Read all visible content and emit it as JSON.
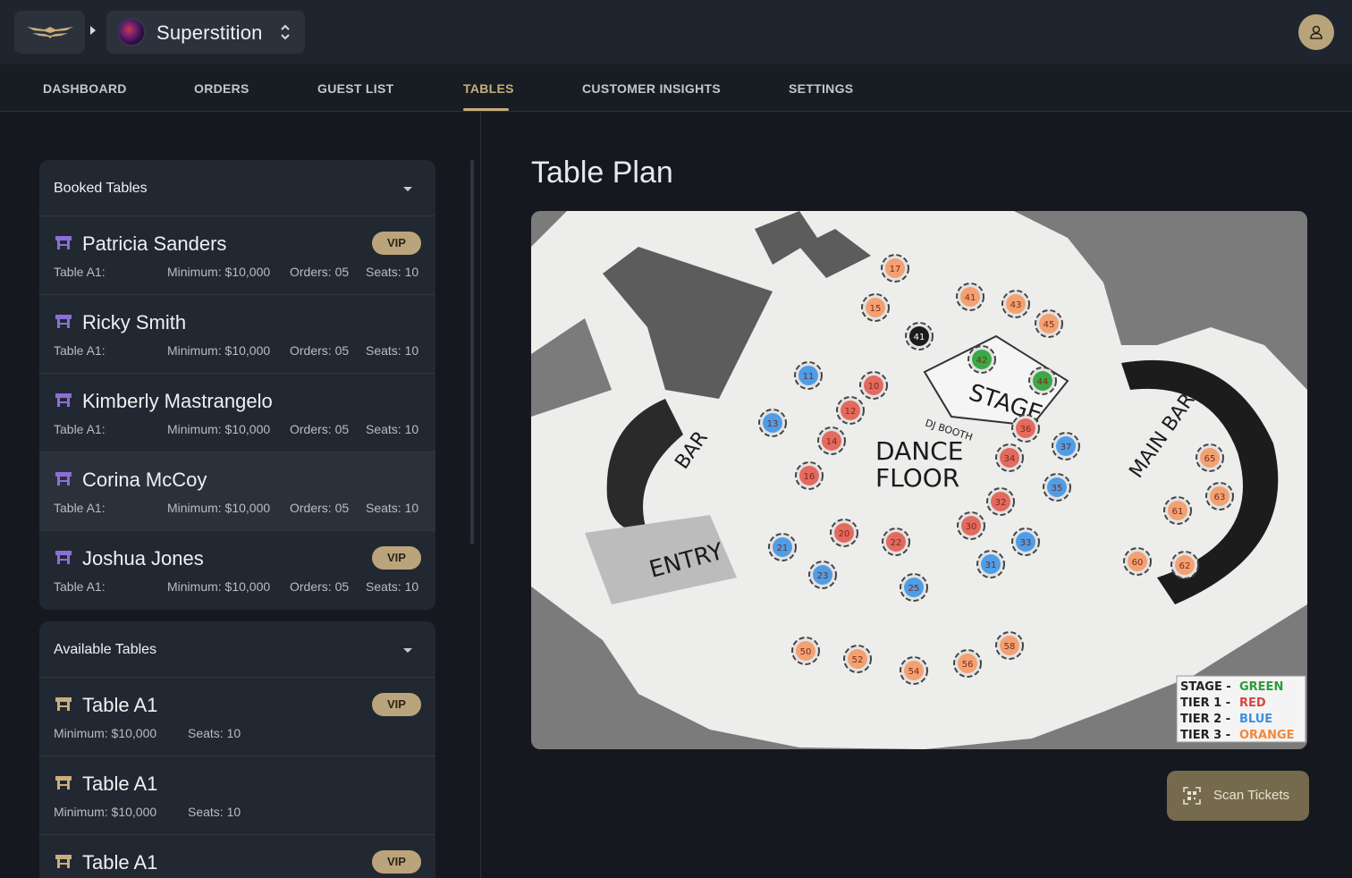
{
  "header": {
    "venue_name": "Superstition",
    "icons": {
      "logo": "wings-logo-icon",
      "breadcrumb": "chevron-right-icon",
      "switcher": "up-down-chevron-icon",
      "user": "user-icon"
    }
  },
  "nav": {
    "tabs": [
      {
        "label": "DASHBOARD"
      },
      {
        "label": "ORDERS"
      },
      {
        "label": "GUEST LIST"
      },
      {
        "label": "TABLES",
        "active": true
      },
      {
        "label": "CUSTOMER INSIGHTS"
      },
      {
        "label": "SETTINGS"
      }
    ]
  },
  "booked": {
    "title": "Booked Tables",
    "rows": [
      {
        "name": "Patricia Sanders",
        "table": "Table A1:",
        "minimum": "Minimum: $10,000",
        "orders": "Orders: 05",
        "seats": "Seats: 10",
        "vip": "VIP"
      },
      {
        "name": "Ricky Smith",
        "table": "Table A1:",
        "minimum": "Minimum: $10,000",
        "orders": "Orders: 05",
        "seats": "Seats: 10"
      },
      {
        "name": "Kimberly Mastrangelo",
        "table": "Table A1:",
        "minimum": "Minimum: $10,000",
        "orders": "Orders: 05",
        "seats": "Seats: 10"
      },
      {
        "name": "Corina McCoy",
        "table": "Table A1:",
        "minimum": "Minimum: $10,000",
        "orders": "Orders: 05",
        "seats": "Seats: 10",
        "selected": true
      },
      {
        "name": "Joshua Jones",
        "table": "Table A1:",
        "minimum": "Minimum: $10,000",
        "orders": "Orders: 05",
        "seats": "Seats: 10",
        "vip": "VIP"
      }
    ]
  },
  "available": {
    "title": "Available Tables",
    "rows": [
      {
        "name": "Table A1",
        "minimum": "Minimum: $10,000",
        "seats": "Seats: 10",
        "vip": "VIP"
      },
      {
        "name": "Table A1",
        "minimum": "Minimum: $10,000",
        "seats": "Seats: 10"
      },
      {
        "name": "Table A1",
        "vip": "VIP"
      }
    ]
  },
  "plan": {
    "title": "Table Plan",
    "labels": {
      "stage": "STAGE",
      "dj": "DJ BOOTH",
      "dance1": "DANCE",
      "dance2": "FLOOR",
      "bar": "BAR",
      "main_bar": "MAIN BAR",
      "entry": "ENTRY"
    },
    "legend": [
      {
        "tier": "STAGE - ",
        "color_name": "GREEN",
        "color": "#2e9a3a"
      },
      {
        "tier": "TIER 1 - ",
        "color_name": "RED",
        "color": "#d9463c"
      },
      {
        "tier": "TIER 2 - ",
        "color_name": "BLUE",
        "color": "#3d8fe0"
      },
      {
        "tier": "TIER 3 - ",
        "color_name": "ORANGE",
        "color": "#f08a3c"
      }
    ],
    "colors": {
      "stage": "#3aa846",
      "tier1": "#e36a5e",
      "tier2": "#4f9de6",
      "tier3": "#f3a172",
      "selected": "#1b1b1b"
    },
    "tables": [
      {
        "n": "17",
        "tier": "tier3"
      },
      {
        "n": "15",
        "tier": "tier3"
      },
      {
        "n": "41",
        "tier": "selected"
      },
      {
        "n": "41",
        "tier": "tier3"
      },
      {
        "n": "43",
        "tier": "tier3"
      },
      {
        "n": "45",
        "tier": "tier3"
      },
      {
        "n": "42",
        "tier": "stage"
      },
      {
        "n": "44",
        "tier": "stage"
      },
      {
        "n": "11",
        "tier": "tier2"
      },
      {
        "n": "13",
        "tier": "tier2"
      },
      {
        "n": "10",
        "tier": "tier1"
      },
      {
        "n": "12",
        "tier": "tier1"
      },
      {
        "n": "14",
        "tier": "tier1"
      },
      {
        "n": "16",
        "tier": "tier1"
      },
      {
        "n": "36",
        "tier": "tier1"
      },
      {
        "n": "34",
        "tier": "tier1"
      },
      {
        "n": "32",
        "tier": "tier1"
      },
      {
        "n": "30",
        "tier": "tier1"
      },
      {
        "n": "37",
        "tier": "tier2"
      },
      {
        "n": "35",
        "tier": "tier2"
      },
      {
        "n": "33",
        "tier": "tier2"
      },
      {
        "n": "31",
        "tier": "tier2"
      },
      {
        "n": "20",
        "tier": "tier1"
      },
      {
        "n": "22",
        "tier": "tier1"
      },
      {
        "n": "21",
        "tier": "tier2"
      },
      {
        "n": "23",
        "tier": "tier2"
      },
      {
        "n": "25",
        "tier": "tier2"
      },
      {
        "n": "65",
        "tier": "tier3"
      },
      {
        "n": "63",
        "tier": "tier3"
      },
      {
        "n": "61",
        "tier": "tier3"
      },
      {
        "n": "60",
        "tier": "tier3"
      },
      {
        "n": "62",
        "tier": "tier3"
      },
      {
        "n": "50",
        "tier": "tier3"
      },
      {
        "n": "52",
        "tier": "tier3"
      },
      {
        "n": "54",
        "tier": "tier3"
      },
      {
        "n": "56",
        "tier": "tier3"
      },
      {
        "n": "58",
        "tier": "tier3"
      }
    ]
  },
  "scan": {
    "label": "Scan Tickets",
    "icon": "qr-scan-icon"
  }
}
